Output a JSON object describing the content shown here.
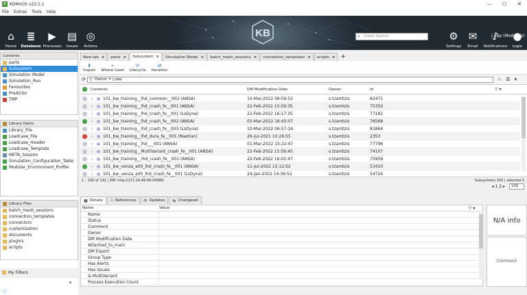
{
  "app": {
    "title": "KOMVOS v23.1.1",
    "logo_text": "K"
  },
  "window_controls": [
    "—",
    "☐",
    "✕"
  ],
  "menu": [
    "File",
    "Extras",
    "Tools",
    "Help"
  ],
  "ribbon": {
    "left": [
      {
        "label": "Home",
        "icon": "home-icon",
        "glyph": "⌂"
      },
      {
        "label": "Database",
        "icon": "database-icon",
        "glyph": "≣",
        "active": true
      },
      {
        "label": "Processes",
        "icon": "play-icon",
        "glyph": "▶"
      },
      {
        "label": "Issues",
        "icon": "issues-icon",
        "glyph": "▤"
      },
      {
        "label": "Actions",
        "icon": "actions-icon",
        "glyph": "◎"
      }
    ],
    "right": [
      {
        "label": "Settings",
        "icon": "gear-icon",
        "glyph": "⚙"
      },
      {
        "label": "Email",
        "icon": "email-icon",
        "glyph": "✉"
      },
      {
        "label": "Notifications",
        "icon": "bell-icon",
        "glyph": "♪"
      },
      {
        "label": "Login",
        "icon": "user-icon",
        "glyph": "●"
      }
    ],
    "search_placeholder": "Quick Search",
    "username": "j.pap (Modelers)"
  },
  "left_panel": {
    "contents": {
      "header": "Contents",
      "items": [
        {
          "label": "parts",
          "icon": "folder"
        },
        {
          "label": "Subsystem",
          "icon": "folder",
          "selected": true
        },
        {
          "label": "Simulation Model",
          "icon": "doc"
        },
        {
          "label": "Simulation_Run",
          "icon": "doc"
        },
        {
          "label": "Favourites",
          "icon": "star"
        },
        {
          "label": "Predictor",
          "icon": "doc"
        },
        {
          "label": "TMP",
          "icon": "red"
        }
      ]
    },
    "library_items": {
      "header": "Library Items",
      "items": [
        "Library_File",
        "Loadcase_File",
        "Loadcase_Header",
        "Loadcase_Template",
        "META_Session",
        "Simulation_Configuration_Table",
        "Modular_Environment_Profile"
      ]
    },
    "library_files": {
      "header": "Library Files",
      "items": [
        "batch_mesh_sessions",
        "connection_templates",
        "connectors",
        "customization",
        "documents",
        "plugins",
        "scripts"
      ]
    },
    "my_filters": "My Filters",
    "collapse_glyph": "«"
  },
  "tabs": [
    {
      "label": "New tab"
    },
    {
      "label": "parts"
    },
    {
      "label": "Subsystem",
      "active": true
    },
    {
      "label": "Simulation Model"
    },
    {
      "label": "batch_mesh_sessions"
    },
    {
      "label": "connection_templates"
    },
    {
      "label": "scripts"
    }
  ],
  "tab_add": "+",
  "toolbar": [
    {
      "label": "Import",
      "icon": "import-icon",
      "glyph": "⬆"
    },
    {
      "label": "Where Used",
      "icon": "where-used-icon",
      "glyph": "⌖"
    },
    {
      "label": "Lifecycle",
      "icon": "lifecycle-icon",
      "glyph": "⟳"
    },
    {
      "label": "Iteration",
      "icon": "iteration-icon",
      "glyph": "⇄"
    }
  ],
  "filter": {
    "value": "Owner = j.pap"
  },
  "table": {
    "columns": [
      "Contents",
      "DM Modification Date",
      "Owner",
      "Id"
    ],
    "rows": [
      {
        "name": "101_bw_training__lhd_common__002 (ANSA)",
        "date": "10-Mar-2022 06:59:52",
        "owner": "s.tzamtzis",
        "id": "82471",
        "status": "#c8c8d8"
      },
      {
        "name": "101_bw_training__lhd_crash_fe__001 (ANSA)",
        "date": "22-Feb-2022 15:59:35",
        "owner": "s.tzamtzis",
        "id": "75350",
        "status": "#c8c8d8"
      },
      {
        "name": "101_bw_training__lhd_crash_fe__001 (LsDyna)",
        "date": "22-Feb-2022 16:17:35",
        "owner": "s.tzamtzis",
        "id": "77181",
        "status": "#c8c8d8"
      },
      {
        "name": "101_bw_training__lhd_crash_fe__002 (ANSA)",
        "date": "05-Mar-2022 16:43:07",
        "owner": "s.tzamtzis",
        "id": "76568",
        "status": "#4aa04a"
      },
      {
        "name": "101_bw_training__lhd_crash_fe__003 (LsDyna)",
        "date": "10-Mar-2022 06:57:16",
        "owner": "s.tzamtzis",
        "id": "81864",
        "status": "#c8c8d8"
      },
      {
        "name": "101_bw_training__lhd_dura_fe__001 (Nastran)",
        "date": "26-Jul-2021 10:26:55",
        "owner": "s.tzamtzis",
        "id": "2353",
        "status": "#d8403a"
      },
      {
        "name": "101_bw_training__lhd___001 (ANSA)",
        "date": "01-Mar-2022 15:22:47",
        "owner": "s.tzamtzis",
        "id": "77796",
        "status": "#c8c8d8"
      },
      {
        "name": "101_bw_training__MultiVariant_crash_fe__001 (ANSA)",
        "date": "22-Feb-2022 15:56:45",
        "owner": "s.tzamtzis",
        "id": "74107",
        "status": "#c8c8d8"
      },
      {
        "name": "101_bw_training__rhd_crash_fe__001 (ANSA)",
        "date": "22-Feb-2022 16:02:47",
        "owner": "s.tzamtzis",
        "id": "75959",
        "status": "#c8c8d8"
      },
      {
        "name": "101_bw_venza_a00_lhd_crash_fe__001 (ANSA)",
        "date": "11-Jul-2022 15:12:52",
        "owner": "s.tzamtzis",
        "id": "53410",
        "status": "#4aa04a"
      },
      {
        "name": "101_bw_venza_a00_lhd_crash_fe__001 (LsDyna)",
        "date": "24-Jan-2022 14:36:52",
        "owner": "s.tzamtzis",
        "id": "54724",
        "status": "#c8c8d8"
      }
    ]
  },
  "status_line": {
    "left": "1 – 100 of 191  |  DM: http://172.24.48.99:34980/",
    "right": "Subsystems 100 | selected 0"
  },
  "pager": {
    "pages": "◂ 1 2 ▸",
    "per_page": "100"
  },
  "bottom_tabs": [
    {
      "label": "Details",
      "glyph": "▦",
      "active": true
    },
    {
      "label": "References",
      "glyph": "⛬"
    },
    {
      "label": "Updates",
      "glyph": "⟳"
    },
    {
      "label": "Changeset",
      "glyph": "⇆"
    }
  ],
  "properties": {
    "columns": [
      "Name",
      "Value"
    ],
    "rows": [
      "Name",
      "Status",
      "Comment",
      "Owner",
      "DM Modification Date",
      "Attached_to_main",
      "DM Export",
      "Group Type",
      "Has Alerts",
      "Has Issues",
      "Is MultiVariant",
      "Process Execution Count"
    ]
  },
  "side_cards": {
    "image": "N/A info",
    "comment": "Comment"
  },
  "bottom_status": "ⓘ"
}
